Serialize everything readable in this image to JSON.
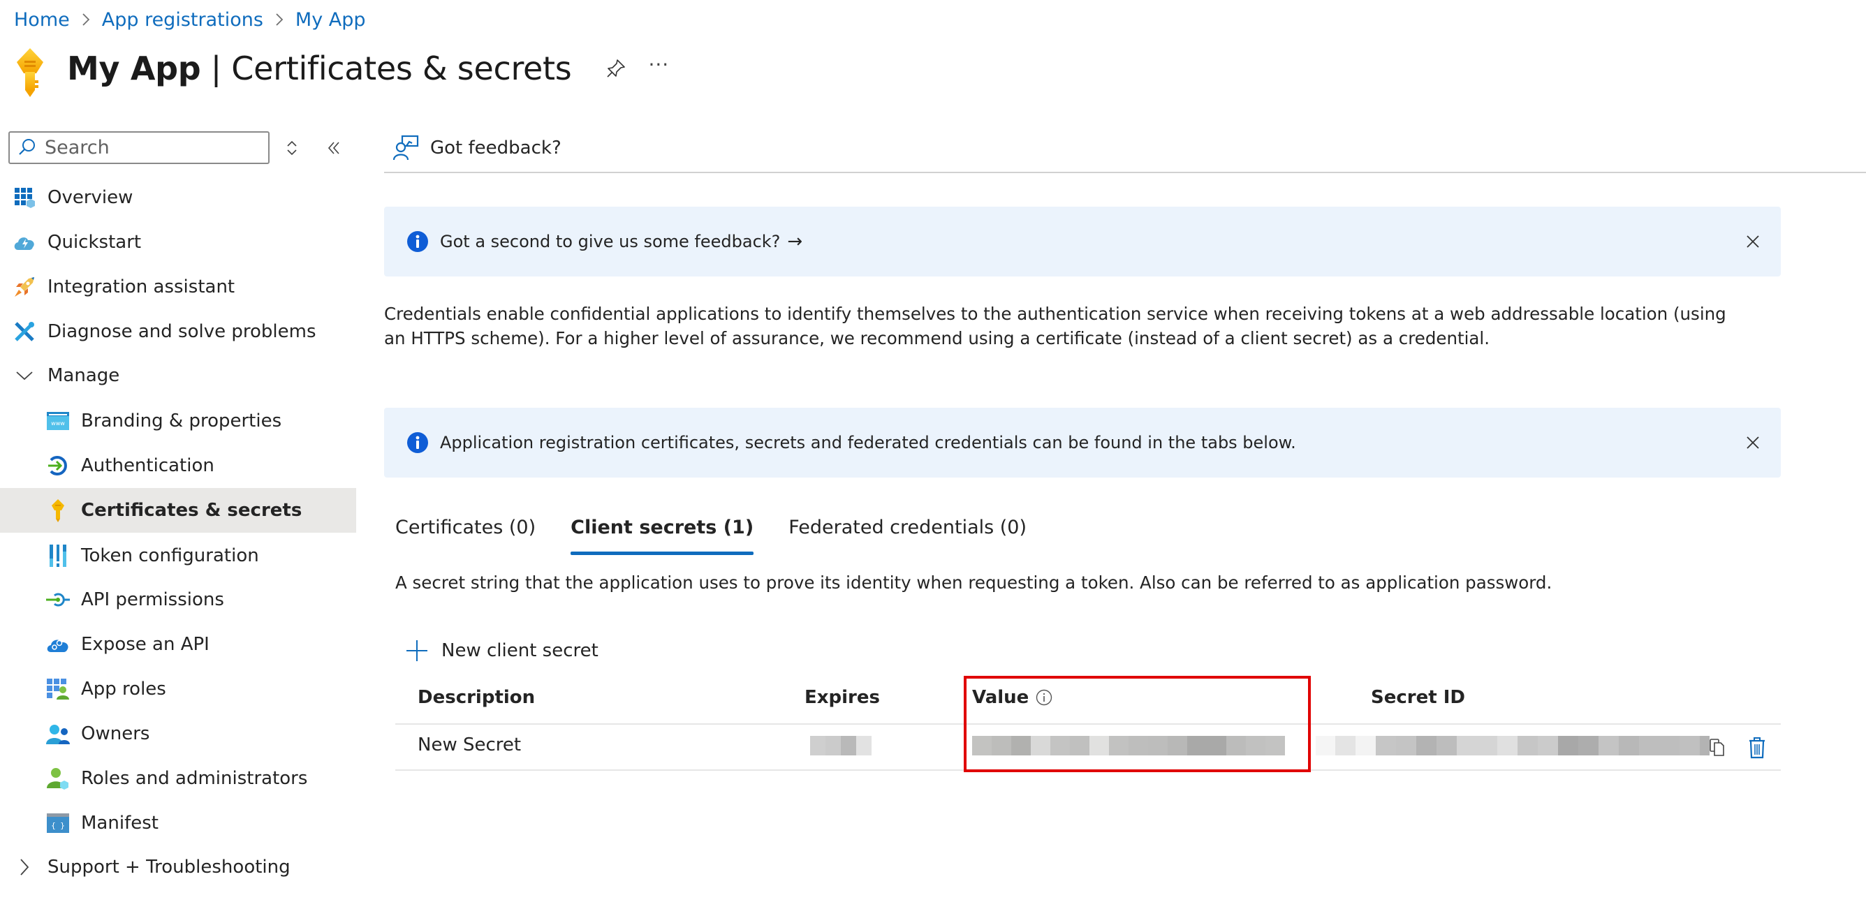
{
  "breadcrumb": [
    {
      "label": "Home"
    },
    {
      "label": "App registrations"
    },
    {
      "label": "My App"
    }
  ],
  "header": {
    "app_name": "My App",
    "separator": " | ",
    "page_name": "Certificates & secrets",
    "pin_icon": "pin-icon",
    "more_label": "···"
  },
  "sidebar": {
    "search_placeholder": "Search",
    "search_value": "",
    "items": [
      {
        "label": "Overview",
        "icon": "overview-grid-icon"
      },
      {
        "label": "Quickstart",
        "icon": "cloud-lightning-icon"
      },
      {
        "label": "Integration assistant",
        "icon": "rocket-icon"
      },
      {
        "label": "Diagnose and solve problems",
        "icon": "wrench-screwdriver-icon"
      },
      {
        "label": "Manage",
        "icon": "chevron-down-icon",
        "expanded": true
      },
      {
        "label": "Branding & properties",
        "icon": "www-window-icon"
      },
      {
        "label": "Authentication",
        "icon": "sign-in-arrow-icon"
      },
      {
        "label": "Certificates & secrets",
        "icon": "key-icon",
        "selected": true
      },
      {
        "label": "Token configuration",
        "icon": "token-bars-icon"
      },
      {
        "label": "API permissions",
        "icon": "api-permissions-icon"
      },
      {
        "label": "Expose an API",
        "icon": "cloud-gears-icon"
      },
      {
        "label": "App roles",
        "icon": "app-roles-icon"
      },
      {
        "label": "Owners",
        "icon": "owners-icon"
      },
      {
        "label": "Roles and administrators",
        "icon": "roles-admin-icon"
      },
      {
        "label": "Manifest",
        "icon": "manifest-braces-icon"
      },
      {
        "label": "Support + Troubleshooting",
        "icon": "chevron-right-icon",
        "expanded": false
      }
    ]
  },
  "command_bar": {
    "feedback_label": "Got feedback?"
  },
  "banners": [
    {
      "text": "Got a second to give us some feedback?",
      "link_arrow": "→"
    },
    {
      "text": "Application registration certificates, secrets and federated credentials can be found in the tabs below."
    }
  ],
  "description": "Credentials enable confidential applications to identify themselves to the authentication service when receiving tokens at a web addressable location (using an HTTPS scheme). For a higher level of assurance, we recommend using a certificate (instead of a client secret) as a credential.",
  "tabs": [
    {
      "label": "Certificates (0)",
      "active": false
    },
    {
      "label": "Client secrets (1)",
      "active": true
    },
    {
      "label": "Federated credentials (0)",
      "active": false
    }
  ],
  "tab_description": "A secret string that the application uses to prove its identity when requesting a token. Also can be referred to as application password.",
  "new_secret_label": "New client secret",
  "table": {
    "columns": [
      "Description",
      "Expires",
      "Value",
      "Secret ID"
    ],
    "rows": [
      {
        "description": "New Secret",
        "expires": "[redacted]",
        "value": "[redacted]",
        "secret_id": "[redacted]"
      }
    ]
  },
  "colors": {
    "accent": "#0f6cbd",
    "banner_bg": "#ebf3fc",
    "selected_nav_bg": "#e9e8e6",
    "highlight_box": "#e00000"
  }
}
